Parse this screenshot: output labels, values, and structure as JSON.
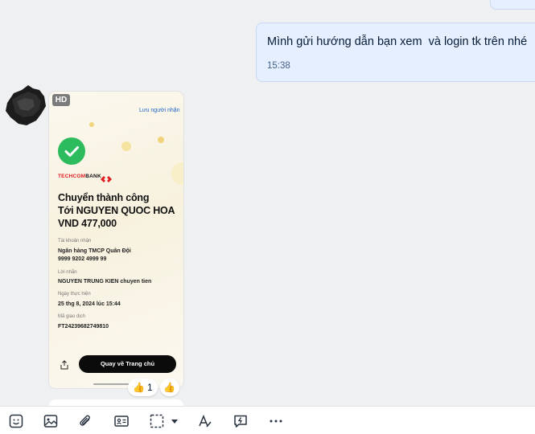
{
  "outgoing_message": {
    "text": "Mình gửi hướng dẫn bạn xem  và login tk trên nhé",
    "time": "15:38"
  },
  "image_message": {
    "hd_badge": "HD",
    "receipt": {
      "save_link": "Lưu người nhận",
      "bank_name_red": "TECHCOM",
      "bank_name_black": "BANK",
      "title_line1": "Chuyển thành công",
      "title_line2": "Tới NGUYEN QUOC HOA",
      "amount": "VND 477,000",
      "account_label": "Tài khoản nhận",
      "account_bank": "Ngân hàng TMCP Quân Đội",
      "account_number": "9999 9202 4999 99",
      "message_label": "Lời nhắn",
      "message_value": "NGUYEN TRUNG KIEN chuyen tien",
      "date_label": "Ngày thực hiện",
      "date_value": "25 thg 8, 2024 lúc 15:44",
      "txn_label": "Mã giao dịch",
      "txn_value": "FT24239682749810",
      "home_button": "Quay về Trang chủ"
    },
    "reactions": [
      {
        "emoji": "👍",
        "count": "1"
      },
      {
        "emoji": "👍",
        "count": ""
      }
    ]
  },
  "toolbar": {
    "icons": [
      "sticker-icon",
      "image-icon",
      "attachment-icon",
      "contact-card-icon",
      "screenshot-icon",
      "text-format-icon",
      "quick-message-icon",
      "more-icon"
    ]
  },
  "colors": {
    "bubble_out": "#e5efff",
    "background": "#eef0f1",
    "success_green": "#2cbb5d",
    "techcombank_red": "#e01b22"
  }
}
